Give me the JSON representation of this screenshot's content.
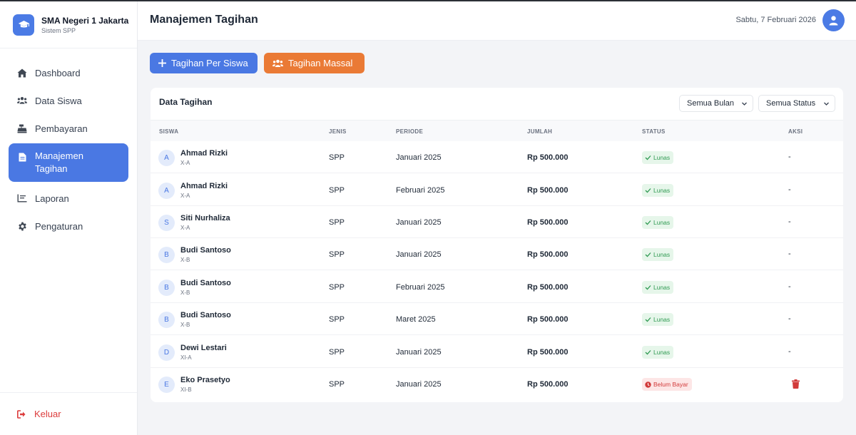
{
  "brand": {
    "name": "SMA Negeri 1 Jakarta",
    "subtitle": "Sistem SPP"
  },
  "nav": [
    {
      "label": "Dashboard",
      "icon": "home-icon"
    },
    {
      "label": "Data Siswa",
      "icon": "users-icon"
    },
    {
      "label": "Pembayaran",
      "icon": "cash-register-icon"
    },
    {
      "label": "Manajemen Tagihan",
      "icon": "invoice-icon",
      "active": true
    },
    {
      "label": "Laporan",
      "icon": "chart-line-icon"
    },
    {
      "label": "Pengaturan",
      "icon": "gear-icon"
    }
  ],
  "logout": "Keluar",
  "header": {
    "title": "Manajemen Tagihan",
    "date": "Sabtu, 7 Februari 2026"
  },
  "actions": {
    "single": "Tagihan Per Siswa",
    "bulk": "Tagihan Massal"
  },
  "card": {
    "title": "Data Tagihan",
    "filter_month": "Semua Bulan",
    "filter_status": "Semua Status"
  },
  "table": {
    "headers": [
      "SISWA",
      "JENIS",
      "PERIODE",
      "JUMLAH",
      "STATUS",
      "AKSI"
    ],
    "rows": [
      {
        "initial": "A",
        "name": "Ahmad Rizki",
        "class": "X-A",
        "type": "SPP",
        "period": "Januari 2025",
        "amount": "Rp 500.000",
        "status": "Lunas",
        "action": "-"
      },
      {
        "initial": "A",
        "name": "Ahmad Rizki",
        "class": "X-A",
        "type": "SPP",
        "period": "Februari 2025",
        "amount": "Rp 500.000",
        "status": "Lunas",
        "action": "-"
      },
      {
        "initial": "S",
        "name": "Siti Nurhaliza",
        "class": "X-A",
        "type": "SPP",
        "period": "Januari 2025",
        "amount": "Rp 500.000",
        "status": "Lunas",
        "action": "-"
      },
      {
        "initial": "B",
        "name": "Budi Santoso",
        "class": "X-B",
        "type": "SPP",
        "period": "Januari 2025",
        "amount": "Rp 500.000",
        "status": "Lunas",
        "action": "-"
      },
      {
        "initial": "B",
        "name": "Budi Santoso",
        "class": "X-B",
        "type": "SPP",
        "period": "Februari 2025",
        "amount": "Rp 500.000",
        "status": "Lunas",
        "action": "-"
      },
      {
        "initial": "B",
        "name": "Budi Santoso",
        "class": "X-B",
        "type": "SPP",
        "period": "Maret 2025",
        "amount": "Rp 500.000",
        "status": "Lunas",
        "action": "-"
      },
      {
        "initial": "D",
        "name": "Dewi Lestari",
        "class": "XI-A",
        "type": "SPP",
        "period": "Januari 2025",
        "amount": "Rp 500.000",
        "status": "Lunas",
        "action": "-"
      },
      {
        "initial": "E",
        "name": "Eko Prasetyo",
        "class": "XI-B",
        "type": "SPP",
        "period": "Januari 2025",
        "amount": "Rp 500.000",
        "status": "Belum Bayar",
        "action": "trash-icon"
      }
    ]
  },
  "colors": {
    "primary": "#4a78e3",
    "orange": "#ea7a35",
    "paid": "#2f9a52",
    "unpaid": "#d23b3b"
  }
}
